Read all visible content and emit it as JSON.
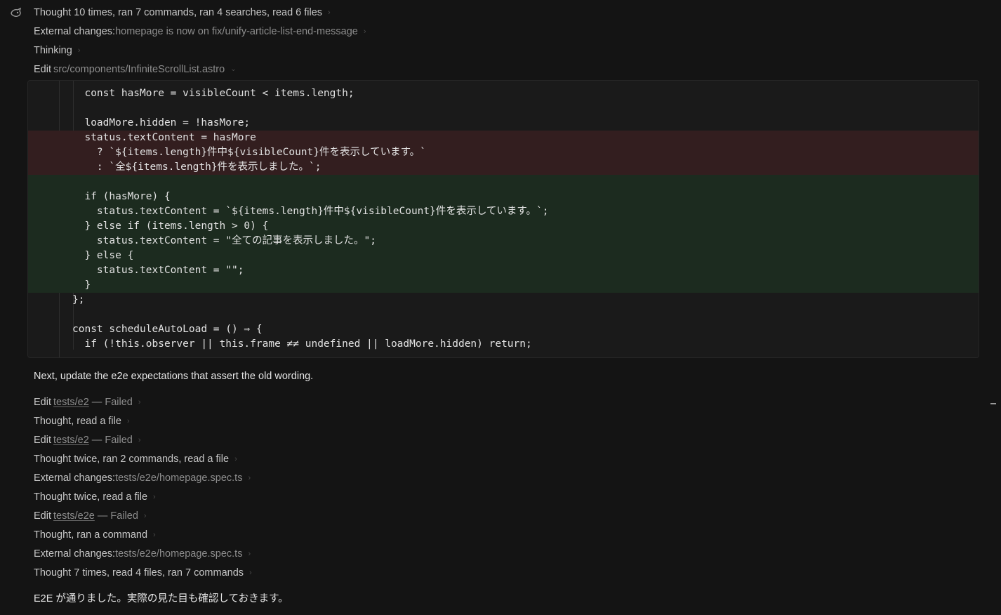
{
  "steps_top": [
    {
      "label": "Thought 10 times, ran 7 commands, ran 4 searches, read 6 files",
      "detail": ""
    },
    {
      "label": "External changes: ",
      "detail": "homepage is now on fix/unify-article-list-end-message"
    },
    {
      "label": "Thinking",
      "detail": ""
    },
    {
      "label": "Edit ",
      "detail": "src/components/InfiniteScrollList.astro",
      "expanded": true
    }
  ],
  "code_lines": [
    {
      "text": "  const hasMore = visibleCount < items.length;",
      "type": "context"
    },
    {
      "text": "",
      "type": "context"
    },
    {
      "text": "  loadMore.hidden = !hasMore;",
      "type": "context"
    },
    {
      "text": "  status.textContent = hasMore",
      "type": "removed"
    },
    {
      "text": "    ? `${items.length}件中${visibleCount}件を表示しています。`",
      "type": "removed"
    },
    {
      "text": "    : `全${items.length}件を表示しました。`;",
      "type": "removed"
    },
    {
      "text": "",
      "type": "added"
    },
    {
      "text": "  if (hasMore) {",
      "type": "added"
    },
    {
      "text": "    status.textContent = `${items.length}件中${visibleCount}件を表示しています。`;",
      "type": "added"
    },
    {
      "text": "  } else if (items.length > 0) {",
      "type": "added"
    },
    {
      "text": "    status.textContent = \"全ての記事を表示しました。\";",
      "type": "added"
    },
    {
      "text": "  } else {",
      "type": "added"
    },
    {
      "text": "    status.textContent = \"\";",
      "type": "added"
    },
    {
      "text": "  }",
      "type": "added"
    },
    {
      "text": "};",
      "type": "context"
    },
    {
      "text": "",
      "type": "context"
    },
    {
      "text": "const scheduleAutoLoad = () ⇒ {",
      "type": "context"
    },
    {
      "text": "  if (!this.observer || this.frame ≠≠ undefined || loadMore.hidden) return;",
      "type": "context"
    }
  ],
  "message_1": "Next, update the e2e expectations that assert the old wording.",
  "steps_bottom": [
    {
      "label": "Edit ",
      "link": "tests/e2",
      "detail": " — Failed"
    },
    {
      "label": "Thought, read a file",
      "link": "",
      "detail": ""
    },
    {
      "label": "Edit ",
      "link": "tests/e2",
      "detail": " — Failed"
    },
    {
      "label": "Thought twice, ran 2 commands, read a file",
      "link": "",
      "detail": ""
    },
    {
      "label": "External changes: ",
      "link": "",
      "detail": "tests/e2e/homepage.spec.ts"
    },
    {
      "label": "Thought twice, read a file",
      "link": "",
      "detail": ""
    },
    {
      "label": "Edit ",
      "link": "tests/e2e",
      "detail": " — Failed"
    },
    {
      "label": "Thought, ran a command",
      "link": "",
      "detail": ""
    },
    {
      "label": "External changes: ",
      "link": "",
      "detail": "tests/e2e/homepage.spec.ts"
    },
    {
      "label": "Thought 7 times, read 4 files, ran 7 commands",
      "link": "",
      "detail": ""
    }
  ],
  "message_2": "E2E が通りました。実際の見た目も確認しておきます。",
  "icons": {
    "agent": "agent-icon",
    "chevron": "chevron-right-icon"
  }
}
